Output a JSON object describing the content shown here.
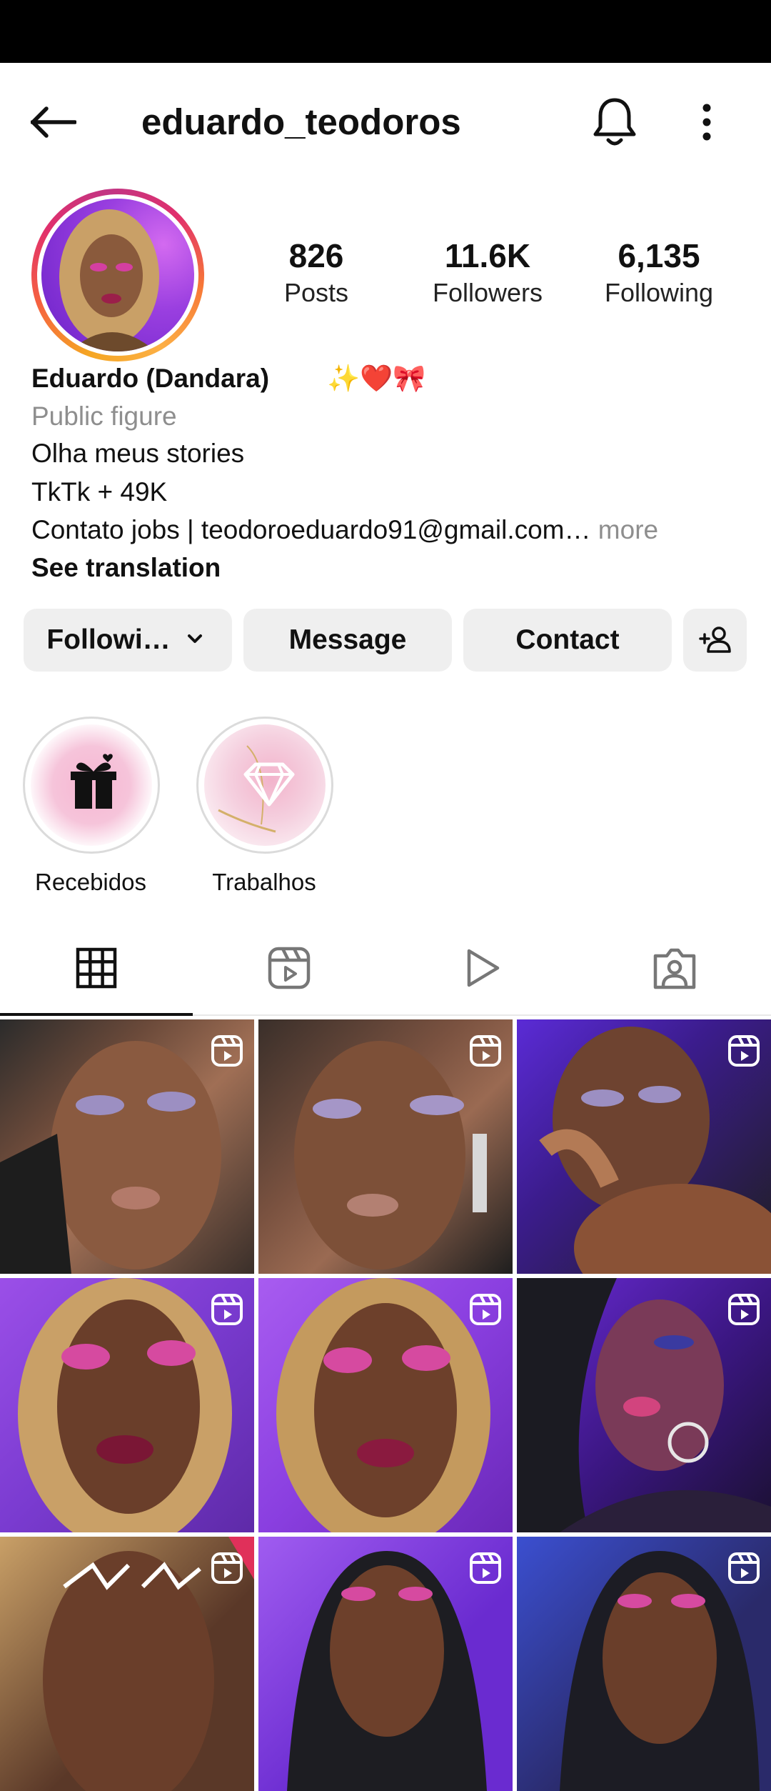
{
  "header": {
    "username": "eduardo_teodoros"
  },
  "profile": {
    "stats": [
      {
        "value": "826",
        "label": "Posts"
      },
      {
        "value": "11.6K",
        "label": "Followers"
      },
      {
        "value": "6,135",
        "label": "Following"
      }
    ],
    "display_name": "Eduardo  (Dandara)",
    "name_emoji": "✨❤️🎀",
    "category": "Public figure",
    "bio_lines": [
      "Olha meus stories",
      "TkTk + 49K",
      "Contato jobs | teodoroeduardo91@gmail.com…"
    ],
    "more_label": "more",
    "see_translation": "See translation"
  },
  "actions": {
    "following_label": "Followi…",
    "message_label": "Message",
    "contact_label": "Contact"
  },
  "highlights": [
    {
      "label": "Recebidos"
    },
    {
      "label": "Trabalhos"
    }
  ],
  "tabs": [
    {
      "icon": "grid-icon",
      "active": true
    },
    {
      "icon": "reels-icon",
      "active": false
    },
    {
      "icon": "play-icon",
      "active": false
    },
    {
      "icon": "tagged-icon",
      "active": false
    }
  ],
  "colors": {
    "button_bg": "#efefef",
    "secondary_text": "#8e8e8e",
    "photo_purple": "#8a2be2"
  }
}
